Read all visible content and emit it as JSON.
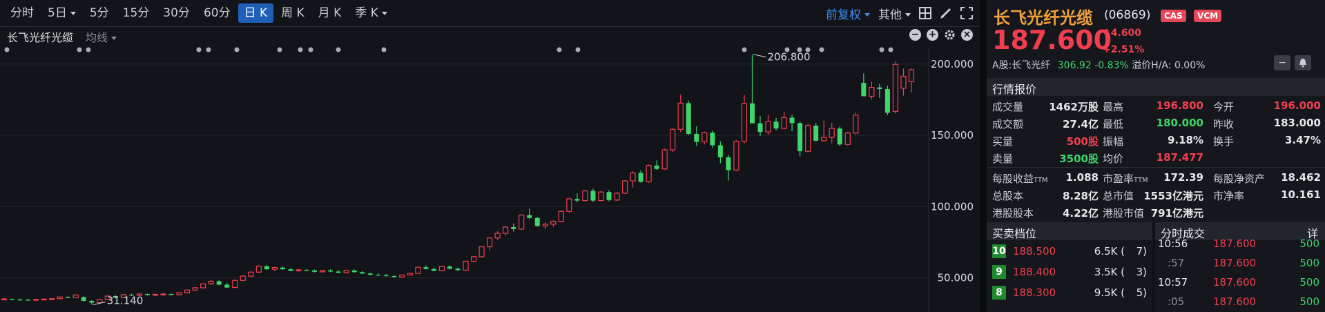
{
  "toolbar": {
    "timeframes": [
      {
        "label": "分时",
        "caret": false,
        "active": false
      },
      {
        "label": "5日",
        "caret": true,
        "active": false
      },
      {
        "label": "5分",
        "caret": false,
        "active": false
      },
      {
        "label": "15分",
        "caret": false,
        "active": false
      },
      {
        "label": "30分",
        "caret": false,
        "active": false
      },
      {
        "label": "60分",
        "caret": false,
        "active": false
      },
      {
        "label": "日 K",
        "caret": false,
        "active": true
      },
      {
        "label": "周 K",
        "caret": false,
        "active": false
      },
      {
        "label": "月 K",
        "caret": false,
        "active": false
      },
      {
        "label": "季 K",
        "caret": true,
        "active": false
      }
    ],
    "adjust": "前复权",
    "other": "其他",
    "icons": [
      "layout-icon",
      "draw-pen-icon",
      "fullscreen-icon"
    ]
  },
  "chart_header": {
    "name": "长飞光纤光缆",
    "ma_label": "均线",
    "controls": [
      "zoom-out-icon",
      "zoom-in-icon",
      "settings-icon",
      "close-icon"
    ]
  },
  "chart_data": {
    "type": "candlestick",
    "y_ticks": [
      "200.000",
      "150.000",
      "100.000",
      "50.000"
    ],
    "y_tick_values": [
      200,
      150,
      100,
      50
    ],
    "annotations": {
      "high": "206.800",
      "low": "31.140"
    },
    "candles": [
      [
        35.0,
        35.8,
        34.2,
        35.2
      ],
      [
        35.2,
        35.6,
        34.4,
        34.8
      ],
      [
        34.8,
        35.4,
        34.0,
        34.6
      ],
      [
        34.6,
        35.2,
        33.8,
        34.4
      ],
      [
        34.4,
        35.0,
        33.6,
        34.9
      ],
      [
        34.9,
        35.6,
        34.2,
        35.1
      ],
      [
        35.1,
        35.8,
        34.6,
        35.4
      ],
      [
        35.4,
        36.8,
        35.0,
        36.6
      ],
      [
        36.6,
        37.2,
        35.8,
        36.0
      ],
      [
        36.0,
        38.4,
        35.8,
        38.0
      ],
      [
        36.5,
        37.0,
        33.4,
        33.8
      ],
      [
        33.8,
        34.2,
        31.14,
        32.6
      ],
      [
        32.6,
        35.2,
        32.2,
        34.8
      ],
      [
        34.8,
        37.6,
        34.4,
        37.2
      ],
      [
        37.2,
        37.8,
        35.6,
        36.2
      ],
      [
        36.2,
        38.6,
        35.8,
        38.2
      ],
      [
        38.2,
        38.8,
        37.2,
        37.8
      ],
      [
        37.8,
        39.2,
        37.2,
        38.6
      ],
      [
        38.6,
        39.0,
        37.6,
        38.0
      ],
      [
        38.0,
        38.8,
        37.2,
        38.4
      ],
      [
        38.4,
        39.6,
        38.0,
        38.6
      ],
      [
        38.6,
        39.0,
        37.8,
        38.2
      ],
      [
        38.2,
        39.8,
        38.0,
        39.6
      ],
      [
        39.6,
        41.8,
        39.0,
        41.4
      ],
      [
        41.4,
        43.6,
        40.8,
        43.0
      ],
      [
        43.0,
        46.2,
        42.6,
        45.8
      ],
      [
        45.8,
        48.4,
        45.0,
        47.6
      ],
      [
        47.6,
        48.2,
        44.8,
        45.2
      ],
      [
        45.2,
        46.4,
        42.8,
        43.2
      ],
      [
        43.2,
        48.8,
        42.8,
        48.2
      ],
      [
        48.2,
        51.8,
        47.6,
        51.2
      ],
      [
        51.2,
        54.6,
        50.6,
        54.0
      ],
      [
        54.0,
        58.8,
        53.4,
        58.2
      ],
      [
        58.2,
        58.8,
        55.6,
        56.0
      ],
      [
        56.0,
        57.8,
        54.8,
        57.2
      ],
      [
        57.2,
        57.8,
        55.6,
        56.0
      ],
      [
        56.0,
        56.8,
        54.6,
        55.0
      ],
      [
        55.0,
        56.2,
        54.2,
        55.6
      ],
      [
        55.6,
        56.4,
        54.8,
        55.2
      ],
      [
        55.2,
        55.8,
        53.8,
        54.2
      ],
      [
        54.2,
        55.6,
        53.6,
        55.2
      ],
      [
        55.2,
        56.0,
        54.0,
        54.4
      ],
      [
        54.4,
        55.4,
        53.2,
        53.6
      ],
      [
        53.6,
        55.6,
        53.2,
        55.2
      ],
      [
        55.2,
        55.8,
        53.6,
        54.0
      ],
      [
        54.0,
        54.8,
        52.6,
        53.0
      ],
      [
        53.0,
        53.6,
        51.8,
        52.2
      ],
      [
        52.2,
        53.2,
        51.4,
        51.8
      ],
      [
        51.8,
        52.6,
        50.8,
        51.2
      ],
      [
        51.2,
        51.8,
        50.0,
        50.6
      ],
      [
        50.6,
        52.4,
        50.2,
        52.0
      ],
      [
        52.0,
        53.6,
        51.6,
        53.2
      ],
      [
        53.2,
        57.8,
        52.8,
        57.4
      ],
      [
        57.4,
        58.6,
        55.8,
        56.2
      ],
      [
        56.2,
        57.2,
        54.6,
        55.0
      ],
      [
        55.0,
        58.6,
        54.6,
        58.0
      ],
      [
        58.0,
        58.8,
        55.8,
        56.4
      ],
      [
        56.4,
        57.2,
        54.8,
        55.4
      ],
      [
        55.4,
        62.2,
        55.0,
        61.6
      ],
      [
        61.6,
        65.4,
        61.0,
        64.8
      ],
      [
        64.8,
        72.4,
        64.2,
        71.8
      ],
      [
        71.8,
        78.6,
        69.2,
        78.0
      ],
      [
        78.0,
        82.6,
        76.4,
        81.2
      ],
      [
        81.2,
        86.4,
        79.6,
        85.6
      ],
      [
        85.6,
        88.2,
        82.4,
        84.2
      ],
      [
        84.2,
        94.6,
        83.6,
        94.0
      ],
      [
        94.0,
        98.6,
        91.2,
        92.0
      ],
      [
        92.0,
        92.6,
        85.8,
        86.4
      ],
      [
        86.4,
        88.8,
        84.2,
        87.6
      ],
      [
        87.6,
        90.4,
        85.6,
        89.6
      ],
      [
        89.6,
        97.2,
        89.0,
        96.6
      ],
      [
        96.6,
        106.2,
        95.8,
        105.4
      ],
      [
        105.4,
        109.2,
        103.0,
        104.2
      ],
      [
        104.2,
        111.6,
        103.6,
        111.0
      ],
      [
        111.0,
        112.6,
        103.2,
        104.2
      ],
      [
        104.2,
        110.8,
        103.4,
        110.2
      ],
      [
        110.2,
        111.4,
        103.6,
        104.6
      ],
      [
        104.6,
        110.2,
        104.0,
        109.4
      ],
      [
        109.4,
        118.6,
        108.8,
        118.0
      ],
      [
        118.0,
        124.8,
        113.4,
        123.6
      ],
      [
        123.6,
        125.4,
        116.8,
        117.4
      ],
      [
        117.4,
        129.6,
        116.6,
        128.8
      ],
      [
        128.8,
        132.4,
        125.8,
        126.4
      ],
      [
        126.4,
        140.6,
        125.8,
        139.8
      ],
      [
        139.8,
        154.8,
        138.2,
        154.2
      ],
      [
        154.2,
        178.6,
        152.4,
        172.6
      ],
      [
        172.6,
        174.4,
        150.2,
        151.0
      ],
      [
        151.0,
        156.2,
        142.6,
        145.4
      ],
      [
        145.4,
        152.6,
        143.8,
        151.8
      ],
      [
        151.8,
        153.4,
        141.2,
        143.0
      ],
      [
        143.0,
        145.6,
        130.4,
        134.6
      ],
      [
        134.6,
        136.2,
        118.2,
        125.6
      ],
      [
        125.6,
        146.6,
        124.8,
        145.8
      ],
      [
        145.8,
        178.4,
        144.4,
        172.4
      ],
      [
        172.4,
        206.8,
        160.6,
        158.4
      ],
      [
        158.4,
        163.6,
        149.6,
        152.4
      ],
      [
        152.4,
        164.4,
        150.2,
        159.6
      ],
      [
        159.6,
        162.2,
        153.6,
        154.8
      ],
      [
        154.8,
        166.2,
        154.2,
        162.4
      ],
      [
        162.4,
        164.6,
        152.8,
        158.6
      ],
      [
        158.6,
        159.4,
        135.2,
        138.8
      ],
      [
        138.8,
        158.2,
        138.2,
        156.8
      ],
      [
        156.8,
        158.6,
        145.8,
        146.2
      ],
      [
        146.2,
        160.4,
        145.6,
        148.6
      ],
      [
        148.6,
        158.8,
        144.4,
        154.8
      ],
      [
        154.8,
        156.2,
        142.4,
        143.6
      ],
      [
        143.6,
        152.4,
        143.0,
        151.6
      ],
      [
        151.6,
        165.8,
        150.8,
        164.2
      ],
      [
        186.8,
        193.4,
        178.4,
        177.4
      ],
      [
        177.4,
        187.6,
        175.2,
        183.6
      ],
      [
        183.6,
        186.2,
        176.2,
        182.4
      ],
      [
        182.4,
        184.8,
        164.2,
        165.8
      ],
      [
        166.8,
        201.8,
        165.2,
        199.8
      ],
      [
        183.0,
        196.8,
        177.8,
        191.4
      ],
      [
        187.6,
        196.8,
        180.0,
        196.0
      ]
    ]
  },
  "quote": {
    "name": "长飞光纤光缆",
    "code": "(06869)",
    "badges": [
      "CAS",
      "VCM"
    ],
    "price": "187.600",
    "change": "4.600",
    "change_pct": "+2.51%",
    "a_share_label": "A股:长飞光纤",
    "a_share_price": "306.92",
    "a_share_pct": "-0.83%",
    "premium_label": "溢价H/A:",
    "premium_value": "0.00%"
  },
  "quotes_section": {
    "title": "行情报价",
    "rows": [
      [
        [
          "成交量",
          "1462万股",
          "white"
        ],
        [
          "最高",
          "196.800",
          "red"
        ],
        [
          "今开",
          "196.000",
          "red"
        ]
      ],
      [
        [
          "成交额",
          "27.4亿",
          "white"
        ],
        [
          "最低",
          "180.000",
          "green"
        ],
        [
          "昨收",
          "183.000",
          "white"
        ]
      ],
      [
        [
          "买量",
          "500股",
          "red"
        ],
        [
          "振幅",
          "9.18%",
          "white"
        ],
        [
          "换手",
          "3.47%",
          "white"
        ]
      ],
      [
        [
          "卖量",
          "3500股",
          "green"
        ],
        [
          "均价",
          "187.477",
          "red"
        ],
        [
          "",
          "",
          " white"
        ]
      ]
    ],
    "rows2": [
      [
        [
          "每股收益",
          "TTM",
          "1.088"
        ],
        [
          "市盈率",
          "TTM",
          "172.39"
        ],
        [
          "每股净资产",
          "",
          "18.462"
        ]
      ],
      [
        [
          "总股本",
          "",
          "8.28亿"
        ],
        [
          "总市值",
          "",
          "1553亿港元"
        ],
        [
          "市净率",
          "",
          "10.161"
        ]
      ],
      [
        [
          "港股股本",
          "",
          "4.22亿"
        ],
        [
          "港股市值",
          "",
          "791亿港元"
        ],
        [
          "",
          "",
          ""
        ]
      ]
    ]
  },
  "orderbook": {
    "title": "买卖档位",
    "rows": [
      {
        "level": "10",
        "price": "188.500",
        "qty": "6.5K (",
        "count": "7)"
      },
      {
        "level": "9",
        "price": "188.400",
        "qty": "3.5K (",
        "count": "3)"
      },
      {
        "level": "8",
        "price": "188.300",
        "qty": "9.5K (",
        "count": "5)"
      }
    ]
  },
  "ticks": {
    "title": "分时成交",
    "detail": "详",
    "rows": [
      {
        "time": "10:56",
        "price": "187.600",
        "vol": "500"
      },
      {
        "time": ":57",
        "price": "187.600",
        "vol": "500"
      },
      {
        "time": "10:57",
        "price": "187.600",
        "vol": "500"
      },
      {
        "time": ":05",
        "price": "187.600",
        "vol": "500"
      }
    ]
  }
}
